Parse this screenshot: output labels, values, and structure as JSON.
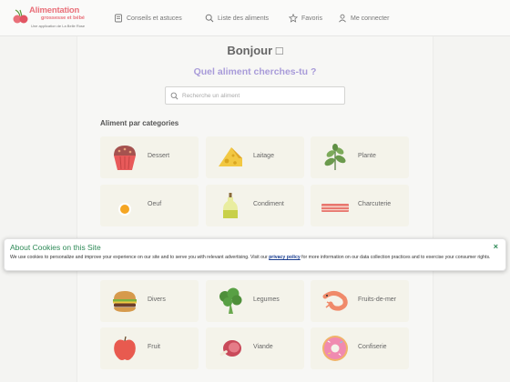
{
  "header": {
    "logo": {
      "title": "Alimentation",
      "subtitle": "grossesse et bébé",
      "tagline": "Une application de La Belle Rose"
    },
    "nav": [
      {
        "label": "Conseils et astuces",
        "icon": "notebook-icon"
      },
      {
        "label": "Liste des aliments",
        "icon": "search-icon"
      },
      {
        "label": "Favoris",
        "icon": "star-icon"
      },
      {
        "label": "Me connecter",
        "icon": "user-icon"
      }
    ]
  },
  "main": {
    "greeting": "Bonjour □",
    "question": "Quel aliment cherches-tu ?",
    "search": {
      "placeholder": "Recherche un aliment",
      "value": ""
    },
    "categories_heading": "Aliment par categories",
    "categories": [
      {
        "label": "Dessert",
        "icon": "cupcake-icon"
      },
      {
        "label": "Laitage",
        "icon": "cheese-icon"
      },
      {
        "label": "Plante",
        "icon": "herb-icon"
      },
      {
        "label": "Oeuf",
        "icon": "egg-icon"
      },
      {
        "label": "Condiment",
        "icon": "oil-bottle-icon"
      },
      {
        "label": "Charcuterie",
        "icon": "bacon-icon"
      },
      {
        "label": "Divers",
        "icon": "burger-icon"
      },
      {
        "label": "Legumes",
        "icon": "broccoli-icon"
      },
      {
        "label": "Fruits-de-mer",
        "icon": "shrimp-icon"
      },
      {
        "label": "Fruit",
        "icon": "apple-icon"
      },
      {
        "label": "Viande",
        "icon": "ham-icon"
      },
      {
        "label": "Confiserie",
        "icon": "donut-icon"
      }
    ]
  },
  "cookie_banner": {
    "title": "About Cookies on this Site",
    "text_before": "We use cookies to personalize and improve your experience on our site and to serve you with relevant advertising. Visit our ",
    "link": "privacy policy",
    "text_after": " for more information on our data collection practices and to exercise your consumer rights.",
    "close": "×"
  },
  "colors": {
    "brand": "#e9707a",
    "accent": "#a89bd9",
    "cookie_title": "#2e8a57",
    "card_bg": "#f4f3ea"
  }
}
